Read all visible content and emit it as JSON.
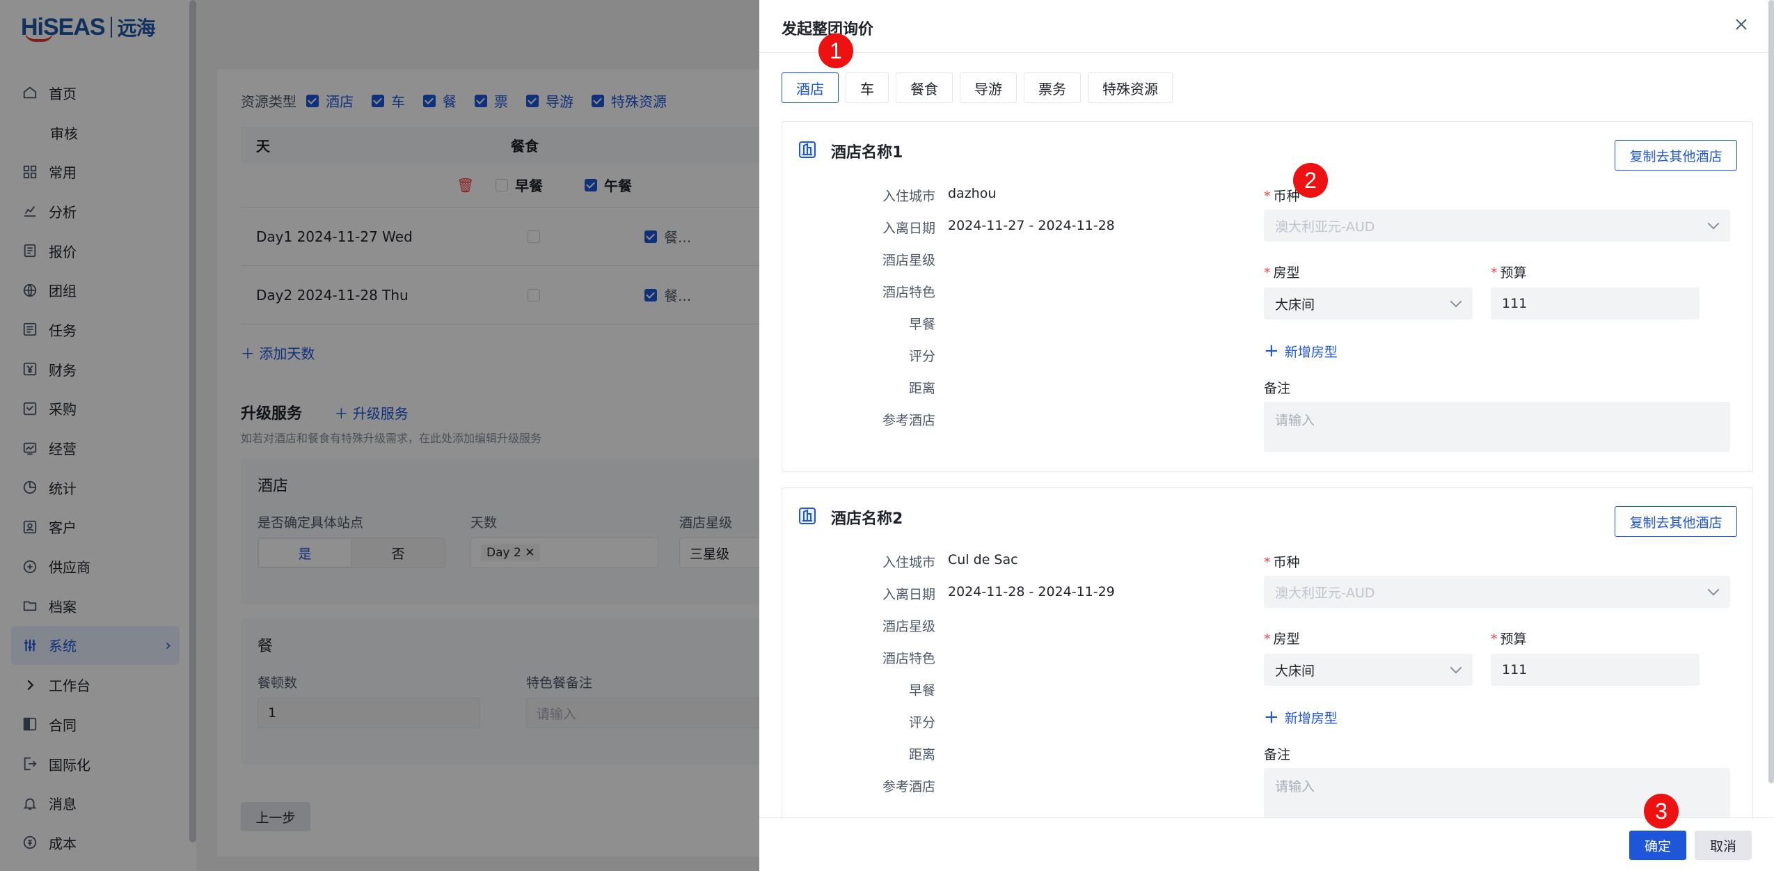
{
  "sidebar": {
    "logo_text": "HiSEAS",
    "logo_cn": "远海",
    "items": [
      {
        "label": "首页",
        "icon": "home-icon"
      },
      {
        "label": "审核",
        "icon": ""
      },
      {
        "label": "常用",
        "icon": "grid-icon"
      },
      {
        "label": "分析",
        "icon": "analytics-icon"
      },
      {
        "label": "报价",
        "icon": "quote-icon"
      },
      {
        "label": "团组",
        "icon": "globe-icon"
      },
      {
        "label": "任务",
        "icon": "task-icon"
      },
      {
        "label": "财务",
        "icon": "yen-icon"
      },
      {
        "label": "采购",
        "icon": "purchase-icon"
      },
      {
        "label": "经营",
        "icon": "operate-icon"
      },
      {
        "label": "统计",
        "icon": "pie-icon"
      },
      {
        "label": "客户",
        "icon": "customer-icon"
      },
      {
        "label": "供应商",
        "icon": "supplier-icon"
      },
      {
        "label": "档案",
        "icon": "folder-icon"
      },
      {
        "label": "系统",
        "icon": "settings-sliders-icon"
      },
      {
        "label": "工作台",
        "icon": "chevron-right-icon"
      },
      {
        "label": "合同",
        "icon": "contract-icon"
      },
      {
        "label": "国际化",
        "icon": "export-icon"
      },
      {
        "label": "消息",
        "icon": "bell-icon"
      },
      {
        "label": "成本",
        "icon": "cost-icon"
      }
    ]
  },
  "background": {
    "resource_type_label": "资源类型",
    "resource_types": [
      "酒店",
      "车",
      "餐",
      "票",
      "导游",
      "特殊资源"
    ],
    "table_head_day": "天",
    "table_head_meal": "餐食",
    "meal_cols": [
      "早餐",
      "午餐"
    ],
    "rows": [
      {
        "day": "Day1 2024-11-27 Wed",
        "lunch": "餐..."
      },
      {
        "day": "Day2 2024-11-28 Thu",
        "lunch": "餐..."
      }
    ],
    "add_day": "添加天数",
    "upgrade_title": "升级服务",
    "upgrade_add": "升级服务",
    "upgrade_hint": "如若对酒店和餐食有特殊升级需求，在此处添加编辑升级服务",
    "hotel_card_title": "酒店",
    "confirm_station_label": "是否确定具体站点",
    "seg_yes": "是",
    "seg_no": "否",
    "days_label": "天数",
    "days_tag": "Day 2",
    "star_label": "酒店星级",
    "star_value": "三星级",
    "meal_card_title": "餐",
    "meal_count_label": "餐顿数",
    "meal_count_value": "1",
    "special_meal_label": "特色餐备注",
    "special_meal_placeholder": "请输入",
    "prev_button": "上一步"
  },
  "drawer": {
    "title": "发起整团询价",
    "tabs": [
      "酒店",
      "车",
      "餐食",
      "导游",
      "票务",
      "特殊资源"
    ],
    "active_tab": 0,
    "info_labels": [
      "入住城市",
      "入离日期",
      "酒店星级",
      "酒店特色",
      "早餐",
      "评分",
      "距离",
      "参考酒店"
    ],
    "copy_button": "复制去其他酒店",
    "currency_label": "币种",
    "currency_value": "澳大利亚元-AUD",
    "room_type_label": "房型",
    "budget_label": "预算",
    "add_room_type": "新增房型",
    "remark_label": "备注",
    "remark_placeholder": "请输入",
    "hotels": [
      {
        "name": "酒店名称1",
        "city": "dazhou",
        "dates": "2024-11-27 - 2024-11-28",
        "room_type": "大床间",
        "budget": "111"
      },
      {
        "name": "酒店名称2",
        "city": "Cul de Sac",
        "dates": "2024-11-28 - 2024-11-29",
        "room_type": "大床间",
        "budget": "111"
      }
    ],
    "ok_button": "确定",
    "cancel_button": "取消"
  },
  "markers": [
    "1",
    "2",
    "3"
  ],
  "colors": {
    "primary": "#1e56d9",
    "marker": "#ee1111",
    "required": "#f53f3f"
  }
}
